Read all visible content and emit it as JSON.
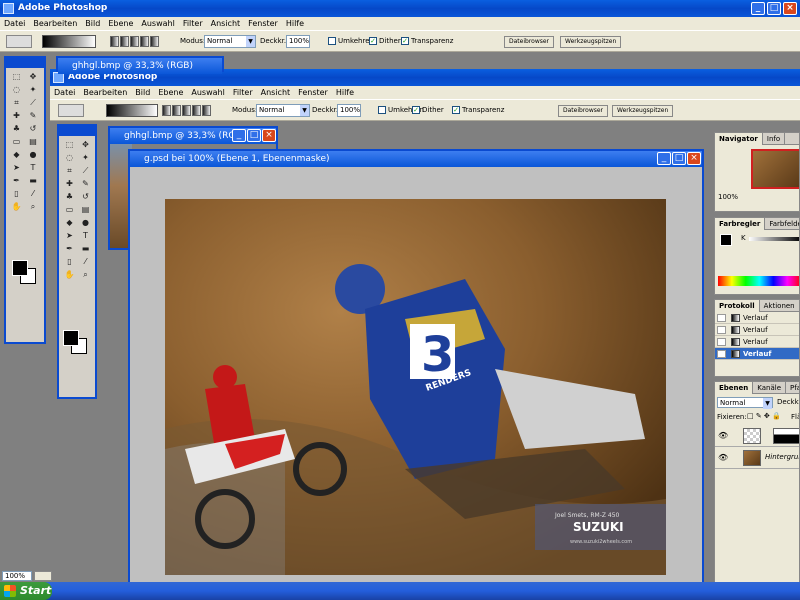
{
  "outer_app": {
    "title": "Adobe Photoshop",
    "menus": [
      "Datei",
      "Bearbeiten",
      "Bild",
      "Ebene",
      "Auswahl",
      "Filter",
      "Ansicht",
      "Fenster",
      "Hilfe"
    ],
    "options": {
      "mode_label": "Modus:",
      "mode_value": "Normal",
      "opacity_label": "Deckkr.:",
      "opacity_value": "100%",
      "reverse_label": "Umkehren",
      "dither_label": "Dither",
      "transparency_label": "Transparenz",
      "tab_filebrowser": "Dateibrowser",
      "tab_toolpresets": "Werkzeugspitzen"
    }
  },
  "inner_app": {
    "title": "Adobe Photoshop",
    "menus": [
      "Datei",
      "Bearbeiten",
      "Bild",
      "Ebene",
      "Auswahl",
      "Filter",
      "Ansicht",
      "Fenster",
      "Hilfe"
    ],
    "options": {
      "mode_label": "Modus:",
      "mode_value": "Normal",
      "opacity_label": "Deckkr.:",
      "opacity_value": "100%",
      "reverse_label": "Umkehren",
      "dither_label": "Dither",
      "transparency_label": "Transparenz",
      "tab_filebrowser": "Dateibrowser",
      "tab_toolpresets": "Werkzeugspitzen"
    }
  },
  "documents": {
    "back_doc_title": "ghhgl.bmp @ 33,3% (RGB)",
    "mid_doc_title": "ghhgl.bmp @ 33,3% (RGB)",
    "front_doc_title": "g.psd bei 100% (Ebene 1, Ebenenmaske)"
  },
  "photo": {
    "rider_name": "Joel Smets, RM-Z 450",
    "brand": "SUZUKI",
    "url": "www.suzuki2wheels.com",
    "jersey_number": "3",
    "chest_text": "RENDERS"
  },
  "panels": {
    "navigator": {
      "tabs": [
        "Navigator",
        "Info"
      ],
      "zoom": "100%"
    },
    "color": {
      "tabs": [
        "Farbregler",
        "Farbfelder"
      ],
      "channel_label": "K"
    },
    "history": {
      "tabs": [
        "Protokoll",
        "Aktionen",
        "W"
      ],
      "items": [
        "Verlauf",
        "Verlauf",
        "Verlauf",
        "Verlauf"
      ],
      "selected_index": 3
    },
    "layers": {
      "tabs": [
        "Ebenen",
        "Kanäle",
        "Pfade"
      ],
      "blend_mode": "Normal",
      "opacity_label": "Deckkr",
      "lock_label": "Fixieren:",
      "fill_label": "Flä",
      "background_layer": "Hintergrund"
    }
  },
  "status": {
    "zoom": "100%"
  },
  "taskbar": {
    "start_label": "Start"
  },
  "window_buttons": {
    "min": "_",
    "max": "□",
    "close": "×"
  }
}
